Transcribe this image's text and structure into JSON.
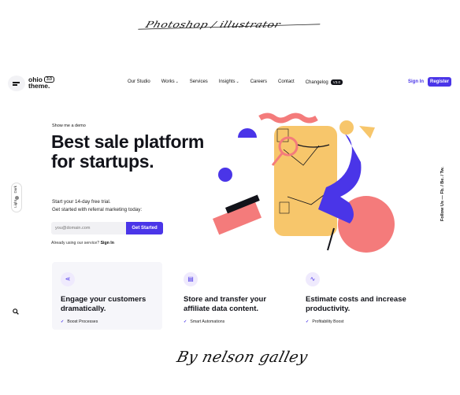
{
  "signature_top": "Photoshop / illustrator",
  "signature_bottom": "By nelson galley",
  "header": {
    "logo_line1": "ohio",
    "logo_line2": "theme.",
    "logo_version": "3.0",
    "nav": [
      {
        "label": "Our Studio",
        "caret": false
      },
      {
        "label": "Works",
        "caret": true
      },
      {
        "label": "Services",
        "caret": false
      },
      {
        "label": "Insights",
        "caret": true
      },
      {
        "label": "Careers",
        "caret": false
      },
      {
        "label": "Contact",
        "caret": false
      },
      {
        "label": "Changelog",
        "caret": false,
        "badge": "V3.0"
      }
    ],
    "signin": "Sign In",
    "register": "Register"
  },
  "hero": {
    "kicker": "Show me a demo",
    "headline": "Best sale platform for startups.",
    "sub1": "Start your 14-day free trial.",
    "sub2": "Get started with referral marketing today:",
    "email_placeholder": "you@domain.com",
    "cta": "Get Started",
    "already_text": "Already using our service?",
    "already_link": "Sign In"
  },
  "rails": {
    "light": "Light",
    "dark": "Dark",
    "social": "Follow Us  —  Fb.  /  Be.  /  Tw.",
    "search_icon": "search-icon"
  },
  "features": [
    {
      "icon": "share-icon",
      "title": "Engage your customers dramatically.",
      "check": "Boost Processes"
    },
    {
      "icon": "database-icon",
      "title": "Store and transfer your affiliate data content.",
      "check": "Smart Automations"
    },
    {
      "icon": "pulse-icon",
      "title": "Estimate costs and increase productivity.",
      "check": "Profitability Boost"
    }
  ],
  "colors": {
    "accent": "#4a35e8",
    "coral": "#f47b7b",
    "yellow": "#f7c66b",
    "dark": "#12131a"
  }
}
